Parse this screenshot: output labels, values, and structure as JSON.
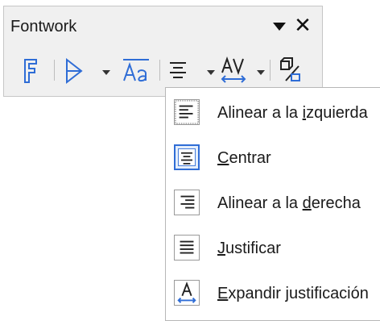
{
  "toolbar": {
    "title": "Fontwork",
    "menu_icon": "triangle-down-icon",
    "close_icon": "close-icon",
    "tools": [
      {
        "name": "fontwork-gallery-icon"
      },
      {
        "name": "fontwork-shape-icon"
      },
      {
        "name": "fontwork-same-letter-heights-icon"
      },
      {
        "name": "fontwork-alignment-icon"
      },
      {
        "name": "fontwork-character-spacing-icon"
      },
      {
        "name": "toggle-extrusion-icon"
      }
    ]
  },
  "alignment_menu": {
    "items": [
      {
        "pre": "Alinear a la ",
        "key": "i",
        "post": "zquierda",
        "icon": "align-left-icon",
        "selected": false
      },
      {
        "pre": "",
        "key": "C",
        "post": "entrar",
        "icon": "align-center-icon",
        "selected": true
      },
      {
        "pre": "Alinear a la ",
        "key": "d",
        "post": "erecha",
        "icon": "align-right-icon",
        "selected": false
      },
      {
        "pre": "",
        "key": "J",
        "post": "ustificar",
        "icon": "justify-icon",
        "selected": false
      },
      {
        "pre": "",
        "key": "E",
        "post": "xpandir justificación",
        "icon": "stretch-justify-icon",
        "selected": false
      }
    ]
  },
  "colors": {
    "accent": "#2f6dd6",
    "toolbar_bg": "#f0f0f0"
  }
}
